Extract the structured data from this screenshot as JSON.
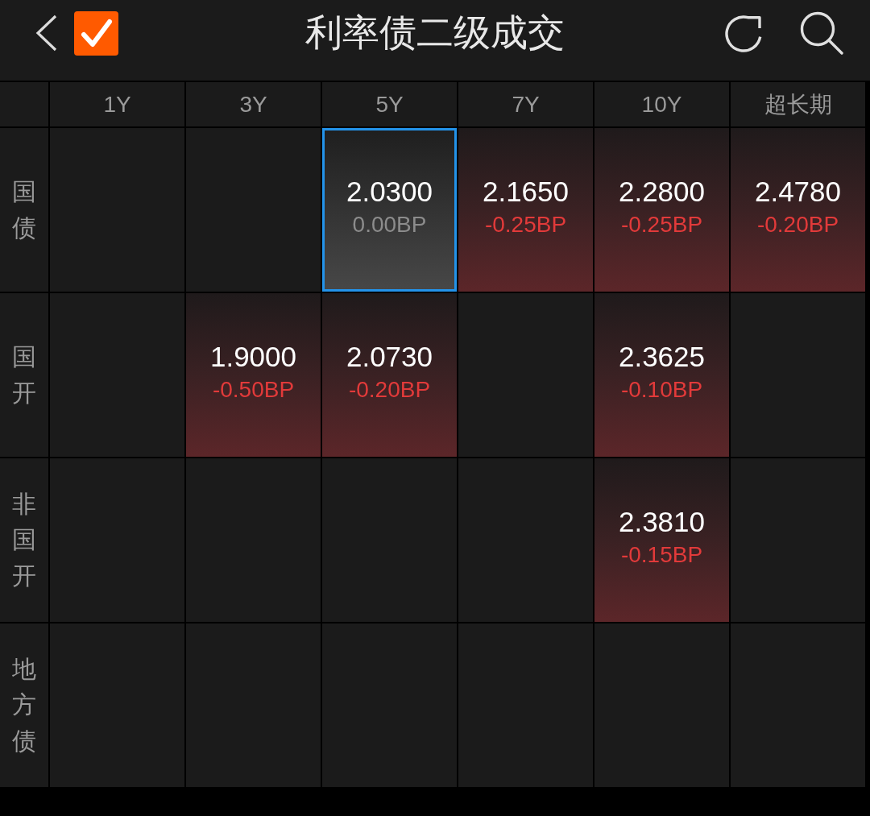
{
  "header": {
    "checkbox": {
      "checked": true
    },
    "title": "利率债二级成交"
  },
  "table": {
    "columns": [
      "1Y",
      "3Y",
      "5Y",
      "7Y",
      "10Y",
      "超长期"
    ],
    "rows": [
      {
        "label": "国债",
        "cells": [
          {
            "kind": "empty",
            "selected": false
          },
          {
            "kind": "empty",
            "selected": false
          },
          {
            "kind": "unchanged",
            "price": "2.0300",
            "change": "0.00BP",
            "selected": true
          },
          {
            "kind": "falling",
            "price": "2.1650",
            "change": "-0.25BP",
            "selected": false
          },
          {
            "kind": "falling",
            "price": "2.2800",
            "change": "-0.25BP",
            "selected": false
          },
          {
            "kind": "falling",
            "price": "2.4780",
            "change": "-0.20BP",
            "selected": false
          }
        ]
      },
      {
        "label": "国开",
        "cells": [
          {
            "kind": "empty",
            "selected": false
          },
          {
            "kind": "falling",
            "price": "1.9000",
            "change": "-0.50BP",
            "selected": false
          },
          {
            "kind": "falling",
            "price": "2.0730",
            "change": "-0.20BP",
            "selected": false
          },
          {
            "kind": "empty",
            "selected": false
          },
          {
            "kind": "falling",
            "price": "2.3625",
            "change": "-0.10BP",
            "selected": false
          },
          {
            "kind": "empty",
            "selected": false
          }
        ]
      },
      {
        "label": "非国开",
        "cells": [
          {
            "kind": "empty",
            "selected": false
          },
          {
            "kind": "empty",
            "selected": false
          },
          {
            "kind": "empty",
            "selected": false
          },
          {
            "kind": "empty",
            "selected": false
          },
          {
            "kind": "falling",
            "price": "2.3810",
            "change": "-0.15BP",
            "selected": false
          },
          {
            "kind": "empty",
            "selected": false
          }
        ]
      },
      {
        "label": "地方债",
        "cells": [
          {
            "kind": "empty",
            "selected": false
          },
          {
            "kind": "empty",
            "selected": false
          },
          {
            "kind": "empty",
            "selected": false
          },
          {
            "kind": "empty",
            "selected": false
          },
          {
            "kind": "empty",
            "selected": false
          },
          {
            "kind": "empty",
            "selected": false
          }
        ]
      }
    ]
  }
}
